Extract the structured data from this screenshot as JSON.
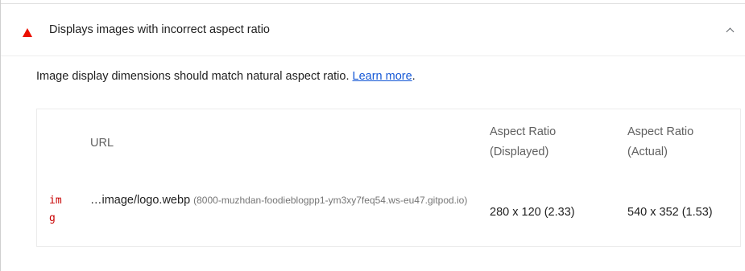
{
  "audit": {
    "title": "Displays images with incorrect aspect ratio",
    "status_color": "#eb0f00",
    "status_icon": "fail-triangle-icon",
    "toggle_icon": "chevron-up-icon",
    "description": "Image display dimensions should match natural aspect ratio.",
    "learn_more": "Learn more",
    "description_end": "."
  },
  "table": {
    "headers": {
      "url": "URL",
      "displayed_line1": "Aspect Ratio",
      "displayed_line2": "(Displayed)",
      "actual_line1": "Aspect Ratio",
      "actual_line2": "(Actual)"
    },
    "rows": [
      {
        "type": "img",
        "url": "…image/logo.webp",
        "host": "(8000-muzhdan-foodieblogpp1-ym3xy7feq54.ws-eu47.gitpod.io)",
        "displayed": "280 x 120 (2.33)",
        "actual": "540 x 352 (1.53)"
      }
    ]
  }
}
